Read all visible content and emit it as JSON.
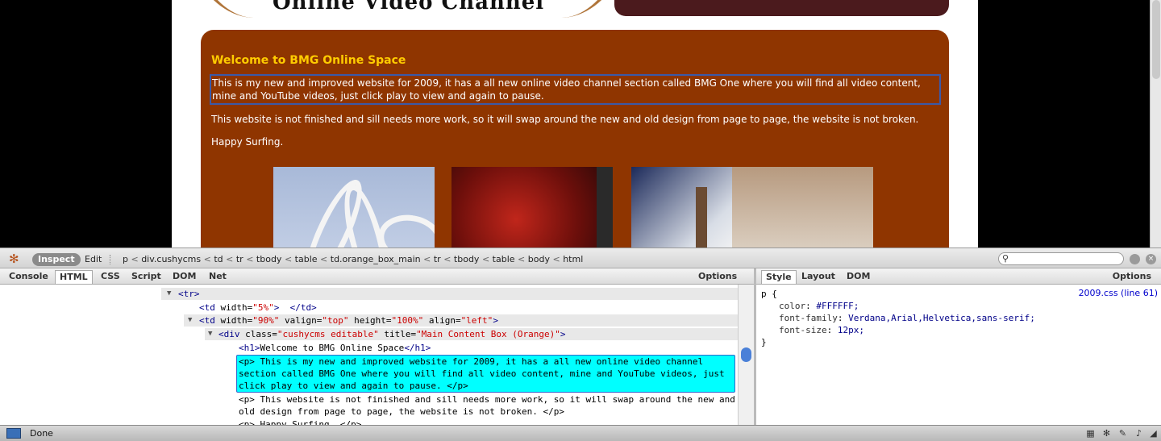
{
  "website": {
    "banner_title": "Online Video Channel",
    "heading": "Welcome to BMG Online Space",
    "paragraph1": "This is my new and improved website for 2009, it has a all new online video channel section called BMG One where you will find all video content, mine and YouTube videos, just click play to view and again to pause.",
    "paragraph2": "This website is not finished and sill needs more work, so it will swap around the new and old design from page to page, the website is not broken.",
    "paragraph3": "Happy Surfing."
  },
  "firebug": {
    "inspect_label": "Inspect",
    "edit_label": "Edit",
    "breadcrumb": [
      "p",
      "div.cushycms",
      "td",
      "tr",
      "tbody",
      "table",
      "td.orange_box_main",
      "tr",
      "tbody",
      "table",
      "body",
      "html"
    ],
    "tabs": [
      "Console",
      "HTML",
      "CSS",
      "Script",
      "DOM",
      "Net"
    ],
    "active_tab": "HTML",
    "options_label": "Options",
    "side_tabs": [
      "Style",
      "Layout",
      "DOM"
    ],
    "side_active_tab": "Style",
    "side_options_label": "Options",
    "css_source": "2009.css (line 61)",
    "css_selector": "p {",
    "css_rules": [
      {
        "prop": "color",
        "value": "#FFFFFF;"
      },
      {
        "prop": "font-family",
        "value": "Verdana,Arial,Helvetica,sans-serif;"
      },
      {
        "prop": "font-size",
        "value": "12px;"
      }
    ],
    "css_close": "}"
  },
  "html_tree": {
    "tr_open": "<tr>",
    "td1": {
      "open": "<td",
      "a1": " width=",
      "v1": "\"5%\"",
      "close": ">  </td>"
    },
    "td2": {
      "open": "<td",
      "a1": " width=",
      "v1": "\"90%\"",
      "a2": " valign=",
      "v2": "\"top\"",
      "a3": " height=",
      "v3": "\"100%\"",
      "a4": " align=",
      "v4": "\"left\"",
      "close": ">"
    },
    "div": {
      "open": "<div",
      "a1": " class=",
      "v1": "\"cushycms editable\"",
      "a2": " title=",
      "v2": "\"Main Content Box (Orange)\"",
      "close": ">"
    },
    "h1": {
      "open": "<h1>",
      "text": "Welcome to BMG Online Space",
      "close": "</h1>"
    },
    "p1_lines": [
      "<p> This is my new and improved website for 2009, it has a all new online video channel",
      "section called BMG One where you will find all video content, mine and YouTube videos, just",
      "click play to view and again to pause. </p>"
    ],
    "p2_lines": [
      "<p> This website is not finished and sill needs more work, so it will swap around the new and",
      "old design from page to page, the website is not broken. </p>"
    ],
    "p3_partial": "<p> Happy Surfing. </p>"
  },
  "status": {
    "text": "Done"
  }
}
